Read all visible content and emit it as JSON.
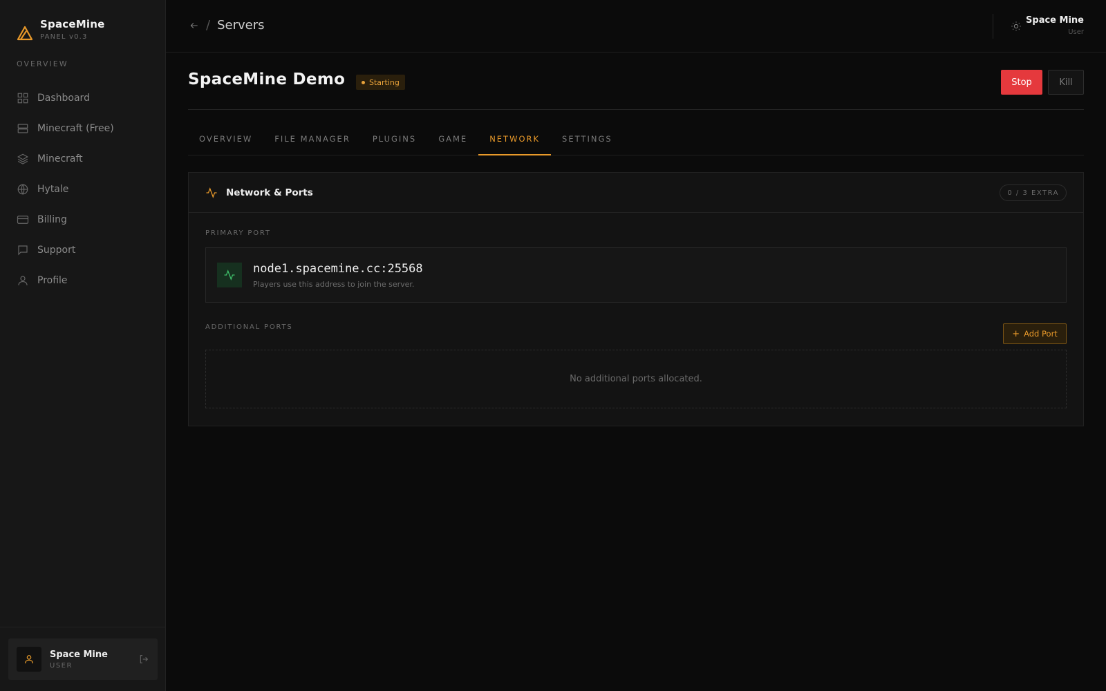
{
  "brand": {
    "name": "SpaceMine",
    "version": "PANEL v0.3"
  },
  "sidebar": {
    "section": "OVERVIEW",
    "items": [
      {
        "label": "Dashboard",
        "icon": "grid-icon"
      },
      {
        "label": "Minecraft (Free)",
        "icon": "server-icon"
      },
      {
        "label": "Minecraft",
        "icon": "layers-icon"
      },
      {
        "label": "Hytale",
        "icon": "globe-icon"
      },
      {
        "label": "Billing",
        "icon": "credit-card-icon"
      },
      {
        "label": "Support",
        "icon": "message-icon"
      },
      {
        "label": "Profile",
        "icon": "user-icon"
      }
    ],
    "user": {
      "name": "Space Mine",
      "role": "USER"
    }
  },
  "header": {
    "breadcrumb": "Servers",
    "user": {
      "name": "Space Mine",
      "role": "User"
    }
  },
  "server": {
    "name": "SpaceMine Demo",
    "status": "Starting",
    "stop_label": "Stop",
    "kill_label": "Kill"
  },
  "tabs": [
    {
      "label": "OVERVIEW",
      "active": false
    },
    {
      "label": "FILE MANAGER",
      "active": false
    },
    {
      "label": "PLUGINS",
      "active": false
    },
    {
      "label": "GAME",
      "active": false
    },
    {
      "label": "NETWORK",
      "active": true
    },
    {
      "label": "SETTINGS",
      "active": false
    }
  ],
  "network": {
    "title": "Network & Ports",
    "extra_badge": "0 / 3 EXTRA",
    "primary_label": "PRIMARY PORT",
    "primary_address": "node1.spacemine.cc:25568",
    "primary_hint": "Players use this address to join the server.",
    "additional_label": "ADDITIONAL PORTS",
    "add_port_label": "Add Port",
    "empty_text": "No additional ports allocated."
  },
  "colors": {
    "accent": "#e8992a",
    "danger": "#e5393d",
    "success": "#3fbf6a",
    "background": "#0b0b0b",
    "sidebar": "#171717"
  }
}
